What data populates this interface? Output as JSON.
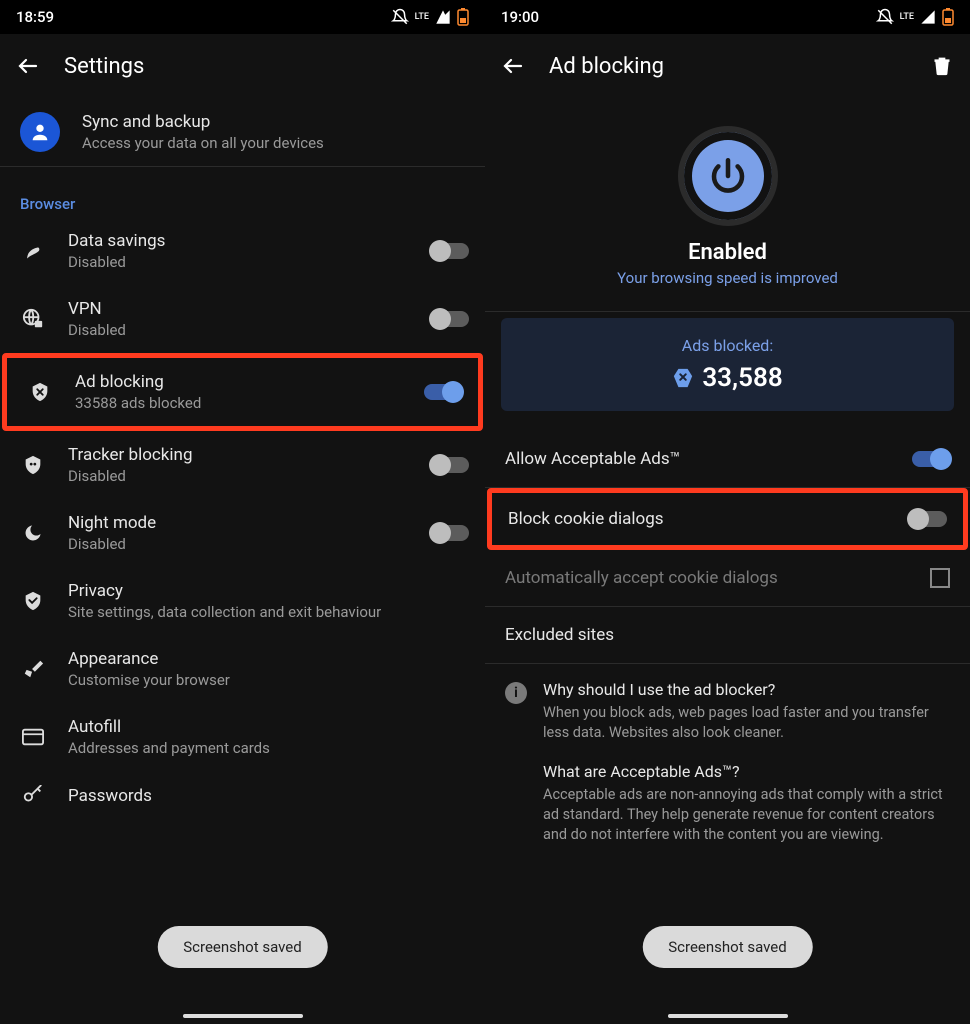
{
  "left": {
    "time": "18:59",
    "appbar_title": "Settings",
    "sync": {
      "title": "Sync and backup",
      "sub": "Access your data on all your devices"
    },
    "section_browser": "Browser",
    "items": [
      {
        "title": "Data savings",
        "sub": "Disabled"
      },
      {
        "title": "VPN",
        "sub": "Disabled"
      },
      {
        "title": "Ad blocking",
        "sub": "33588 ads blocked"
      },
      {
        "title": "Tracker blocking",
        "sub": "Disabled"
      },
      {
        "title": "Night mode",
        "sub": "Disabled"
      },
      {
        "title": "Privacy",
        "sub": "Site settings, data collection and exit behaviour"
      },
      {
        "title": "Appearance",
        "sub": "Customise your browser"
      },
      {
        "title": "Autofill",
        "sub": "Addresses and payment cards"
      },
      {
        "title": "Passwords",
        "sub": ""
      }
    ],
    "toast": "Screenshot saved"
  },
  "right": {
    "time": "19:00",
    "appbar_title": "Ad blocking",
    "enabled": "Enabled",
    "enabled_sub": "Your browsing speed is improved",
    "stats_label": "Ads blocked:",
    "stats_value": "33,588",
    "allow_ads": "Allow Acceptable Ads™",
    "block_cookie": "Block cookie dialogs",
    "auto_accept": "Automatically accept cookie dialogs",
    "excluded": "Excluded sites",
    "faq": {
      "q1": "Why should I use the ad blocker?",
      "a1": "When you block ads, web pages load faster and you transfer less data. Websites also look cleaner.",
      "q2": "What are Acceptable Ads™?",
      "a2": "Acceptable ads are non-annoying ads that comply with a strict ad standard. They help generate revenue for content creators and do not interfere with the content you are viewing."
    },
    "toast": "Screenshot saved"
  },
  "status_lte": "LTE"
}
